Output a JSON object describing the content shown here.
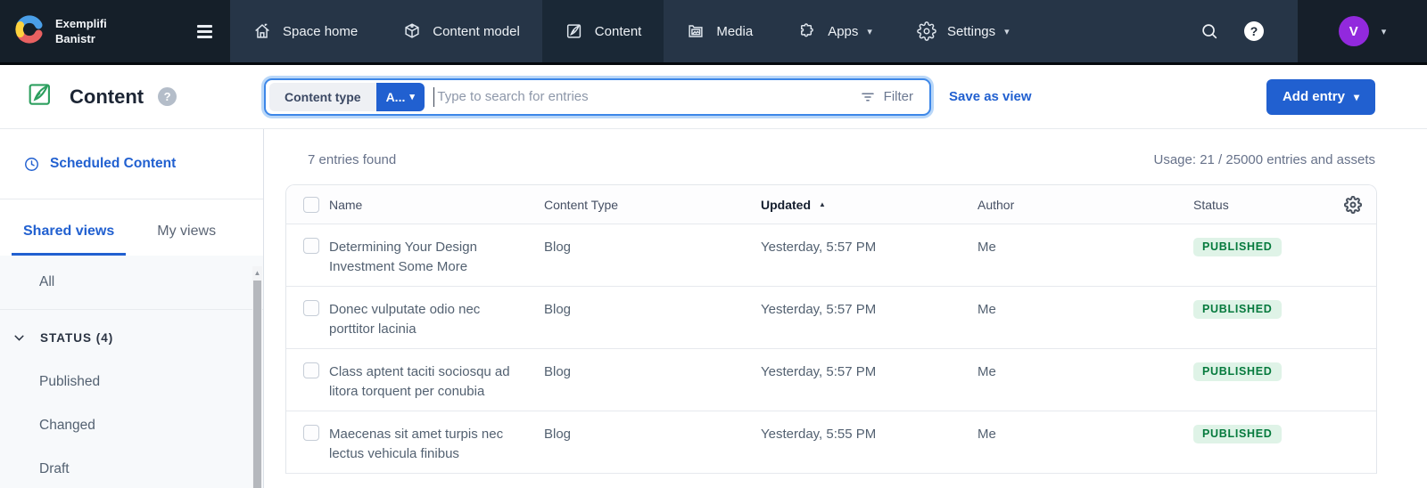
{
  "colors": {
    "accent_blue": "#2160d0",
    "topbar_bg": "#263547",
    "badge_bg": "#dff3e7",
    "badge_text": "#067a3d",
    "avatar_purple": "#9229dd",
    "brand_green": "#2d9f5f"
  },
  "topbar": {
    "org_line1": "Exemplifi",
    "org_line2": "Banistr",
    "nav": [
      {
        "label": "Space home"
      },
      {
        "label": "Content model"
      },
      {
        "label": "Content"
      },
      {
        "label": "Media"
      },
      {
        "label": "Apps"
      },
      {
        "label": "Settings"
      }
    ],
    "avatar_letter": "V"
  },
  "header": {
    "title": "Content",
    "search": {
      "scope_label": "Content type",
      "scope_value": "A...",
      "placeholder": "Type to search for entries",
      "filter_label": "Filter"
    },
    "save_as_view": "Save as view",
    "add_entry": "Add entry"
  },
  "sidebar": {
    "scheduled_content": "Scheduled Content",
    "tabs": [
      {
        "label": "Shared views",
        "active": true
      },
      {
        "label": "My views",
        "active": false
      }
    ],
    "views": {
      "all": "All",
      "status_group": "STATUS (4)",
      "status_items": [
        "Published",
        "Changed",
        "Draft"
      ]
    }
  },
  "main": {
    "entries_found": "7 entries found",
    "usage": "Usage: 21 / 25000 entries and assets",
    "table": {
      "headers": {
        "name": "Name",
        "content_type": "Content Type",
        "updated": "Updated",
        "author": "Author",
        "status": "Status"
      },
      "sorted_by": "Updated",
      "sort_direction": "asc",
      "rows": [
        {
          "name": "Determining Your Design Investment Some More",
          "content_type": "Blog",
          "updated": "Yesterday, 5:57 PM",
          "author": "Me",
          "status": "PUBLISHED"
        },
        {
          "name": "Donec vulputate odio nec porttitor lacinia",
          "content_type": "Blog",
          "updated": "Yesterday, 5:57 PM",
          "author": "Me",
          "status": "PUBLISHED"
        },
        {
          "name": "Class aptent taciti sociosqu ad litora torquent per conubia",
          "content_type": "Blog",
          "updated": "Yesterday, 5:57 PM",
          "author": "Me",
          "status": "PUBLISHED"
        },
        {
          "name": "Maecenas sit amet turpis nec lectus vehicula finibus",
          "content_type": "Blog",
          "updated": "Yesterday, 5:55 PM",
          "author": "Me",
          "status": "PUBLISHED"
        }
      ]
    }
  }
}
